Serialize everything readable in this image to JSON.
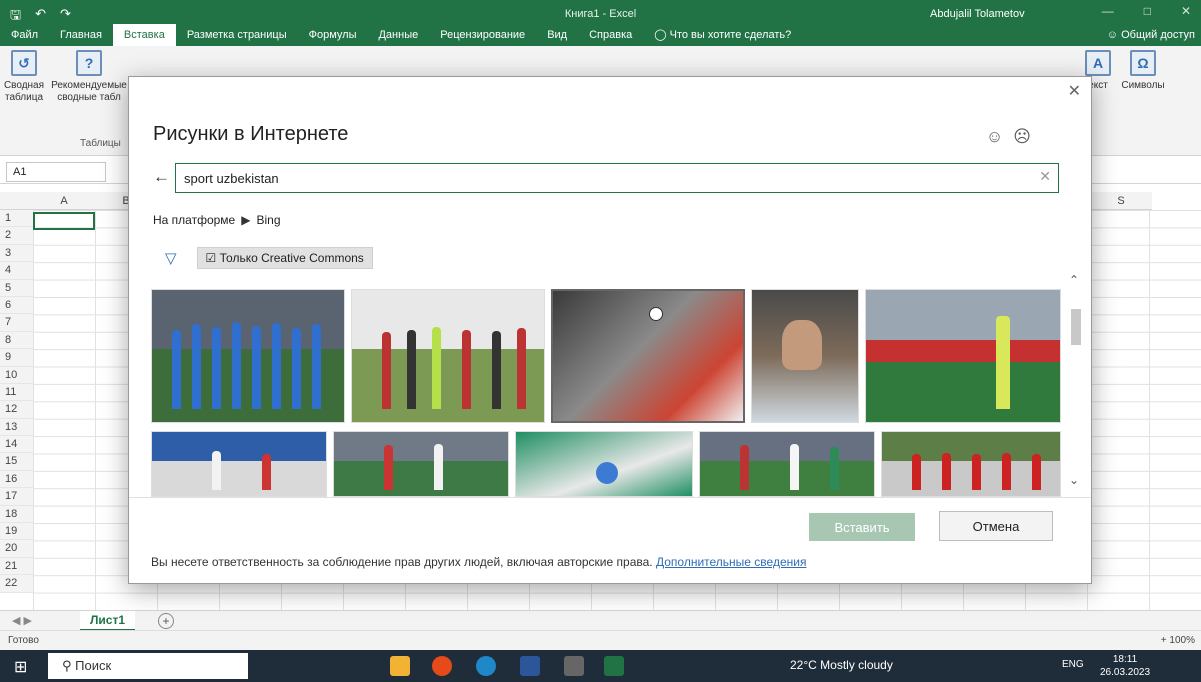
{
  "window": {
    "doc_title": "Книга1  -  Excel",
    "user": "Abdujalil Tolametov"
  },
  "menu": {
    "items": [
      "Файл",
      "Главная",
      "Вставка",
      "Разметка страницы",
      "Формулы",
      "Данные",
      "Рецензирование",
      "Вид",
      "Справка",
      "Что вы хотите сделать?"
    ],
    "active_index": 2,
    "share": "Общий доступ"
  },
  "ribbon": {
    "groups": [
      {
        "label": "Сводная таблица"
      },
      {
        "label": "Рекомендуемые сводные табл"
      },
      {
        "label": "екст"
      },
      {
        "label": "Символы"
      }
    ],
    "group_caption": "Таблицы"
  },
  "formula_bar": {
    "name_box": "A1"
  },
  "grid": {
    "col_a": "A",
    "col_b": "B",
    "col_s": "S",
    "rows": [
      "1",
      "2",
      "3",
      "4",
      "5",
      "6",
      "7",
      "8",
      "9",
      "10",
      "11",
      "12",
      "13",
      "14",
      "15",
      "16",
      "17",
      "18",
      "19",
      "20",
      "21",
      "22"
    ]
  },
  "sheet": {
    "tab": "Лист1",
    "status": "Готово",
    "zoom": "+ 100%"
  },
  "taskbar": {
    "search": "Поиск",
    "weather": "22°C  Mostly cloudy",
    "lang": "ENG",
    "time": "18:11",
    "date": "26.03.2023"
  },
  "dialog": {
    "title": "Рисунки в Интернете",
    "search_value": "sport uzbekistan",
    "platform_label": "На платформе",
    "platform_name": "Bing",
    "cc_filter": "Только Creative Commons",
    "insert_button": "Вставить",
    "cancel_button": "Отмена",
    "footer_text": "Вы несете ответственность за соблюдение прав других людей, включая авторские права.",
    "footer_link": "Дополнительные сведения"
  },
  "colors": {
    "excel_green": "#217346",
    "accent_blue": "#2e6db4"
  }
}
